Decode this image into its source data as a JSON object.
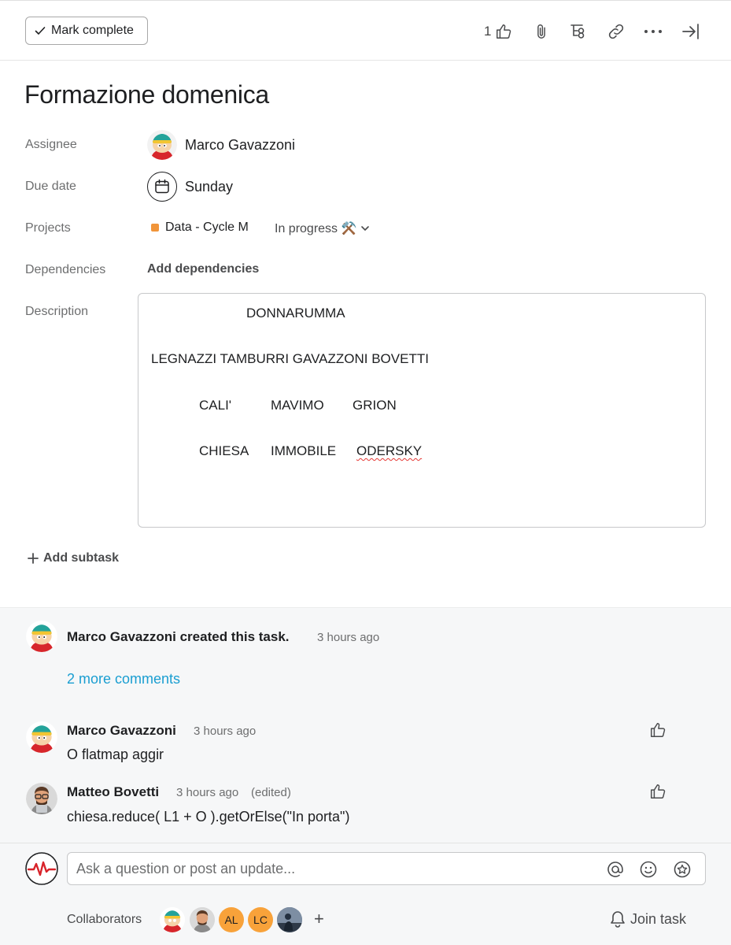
{
  "toolbar": {
    "mark_complete_label": "Mark complete",
    "like_count": "1",
    "icons": [
      "thumbs-up-icon",
      "paperclip-icon",
      "subtask-icon",
      "link-icon",
      "more-icon",
      "close-panel-icon"
    ]
  },
  "task": {
    "title": "Formazione domenica",
    "fields": {
      "assignee_label": "Assignee",
      "assignee_name": "Marco Gavazzoni",
      "due_label": "Due date",
      "due_value": "Sunday",
      "projects_label": "Projects",
      "project_name": "Data - Cycle M",
      "project_color": "#f1953a",
      "project_status": "In progress ⚒️",
      "dependencies_label": "Dependencies",
      "add_dependencies": "Add dependencies",
      "description_label": "Description"
    },
    "description_lines": [
      "DONNARUMMA",
      "LEGNAZZI TAMBURRI GAVAZZONI BOVETTI",
      "CALI'",
      "MAVIMO",
      "GRION",
      "CHIESA",
      "IMMOBILE",
      "ODERSKY"
    ],
    "add_subtask": "Add subtask"
  },
  "activity": {
    "created": {
      "text": "Marco Gavazzoni created this task.",
      "time": "3 hours ago"
    },
    "more_comments": "2 more comments",
    "comments": [
      {
        "author": "Marco Gavazzoni",
        "time": "3 hours ago",
        "edited": "",
        "text": "O flatmap aggir"
      },
      {
        "author": "Matteo Bovetti",
        "time": "3 hours ago",
        "edited": "(edited)",
        "text": "chiesa.reduce( L1 + O ).getOrElse(\"In porta\")"
      }
    ]
  },
  "composer": {
    "placeholder": "Ask a question or post an update...",
    "collaborators_label": "Collaborators",
    "collaborator_initials": [
      "AL",
      "LC"
    ],
    "join_task": "Join task"
  }
}
